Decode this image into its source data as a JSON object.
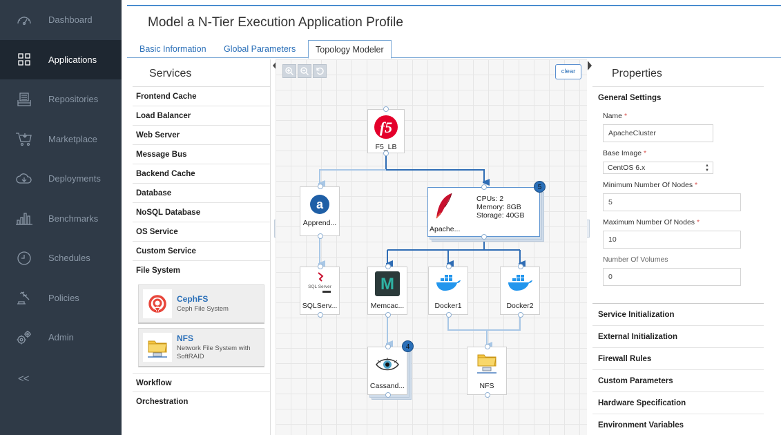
{
  "sidebar": {
    "items": [
      {
        "label": "Dashboard",
        "icon": "dashboard-icon"
      },
      {
        "label": "Applications",
        "icon": "applications-icon",
        "active": true
      },
      {
        "label": "Repositories",
        "icon": "repositories-icon"
      },
      {
        "label": "Marketplace",
        "icon": "cart-icon"
      },
      {
        "label": "Deployments",
        "icon": "cloud-icon"
      },
      {
        "label": "Benchmarks",
        "icon": "bar-chart-icon"
      },
      {
        "label": "Schedules",
        "icon": "clock-icon"
      },
      {
        "label": "Policies",
        "icon": "gavel-icon"
      },
      {
        "label": "Admin",
        "icon": "gears-icon"
      }
    ],
    "collapse_label": "<<"
  },
  "header": {
    "title": "Model a N-Tier Execution Application Profile"
  },
  "tabs": [
    {
      "label": "Basic Information"
    },
    {
      "label": "Global Parameters"
    },
    {
      "label": "Topology Modeler",
      "active": true
    }
  ],
  "services": {
    "title": "Services",
    "items": [
      "Frontend Cache",
      "Load Balancer",
      "Web Server",
      "Message Bus",
      "Backend Cache",
      "Database",
      "NoSQL Database",
      "OS Service",
      "Custom Service",
      "File System"
    ],
    "cards": [
      {
        "name": "CephFS",
        "desc": "Ceph File System",
        "icon": "ceph-icon"
      },
      {
        "name": "NFS",
        "desc": "Network File System with SoftRAID",
        "icon": "folder-network-icon"
      }
    ],
    "after": [
      "Workflow",
      "Orchestration"
    ]
  },
  "canvas": {
    "clear_label": "clear",
    "toolbar": [
      "zoom-in-icon",
      "zoom-out-icon",
      "reset-icon"
    ],
    "nodes": {
      "f5": {
        "label": "F5_LB"
      },
      "appr": {
        "label": "Apprend..."
      },
      "apache": {
        "label": "Apache...",
        "stats": [
          "CPUs: 2",
          "Memory: 8GB",
          "Storage: 40GB"
        ],
        "badge": "5"
      },
      "sql": {
        "label": "SQLServ..."
      },
      "memc": {
        "label": "Memcac..."
      },
      "dock1": {
        "label": "Docker1"
      },
      "dock2": {
        "label": "Docker2"
      },
      "cass": {
        "label": "Cassand...",
        "badge": "4"
      },
      "nfs": {
        "label": "NFS"
      }
    }
  },
  "properties": {
    "title": "Properties",
    "general_heading": "General Settings",
    "name_label": "Name",
    "name_value": "ApacheCluster",
    "base_image_label": "Base Image",
    "base_image_value": "CentOS 6.x",
    "min_nodes_label": "Minimum Number Of Nodes",
    "min_nodes_value": "5",
    "max_nodes_label": "Maximum Number Of Nodes",
    "max_nodes_value": "10",
    "volumes_label": "Number Of Volumes",
    "volumes_value": "0",
    "sections": [
      "Service Initialization",
      "External Initialization",
      "Firewall Rules",
      "Custom Parameters",
      "Hardware Specification",
      "Environment Variables"
    ]
  },
  "colors": {
    "accent": "#2a6fb8",
    "sidebar_bg": "#2f3a47",
    "sidebar_active": "#1e2731",
    "required": "#d9534f"
  }
}
